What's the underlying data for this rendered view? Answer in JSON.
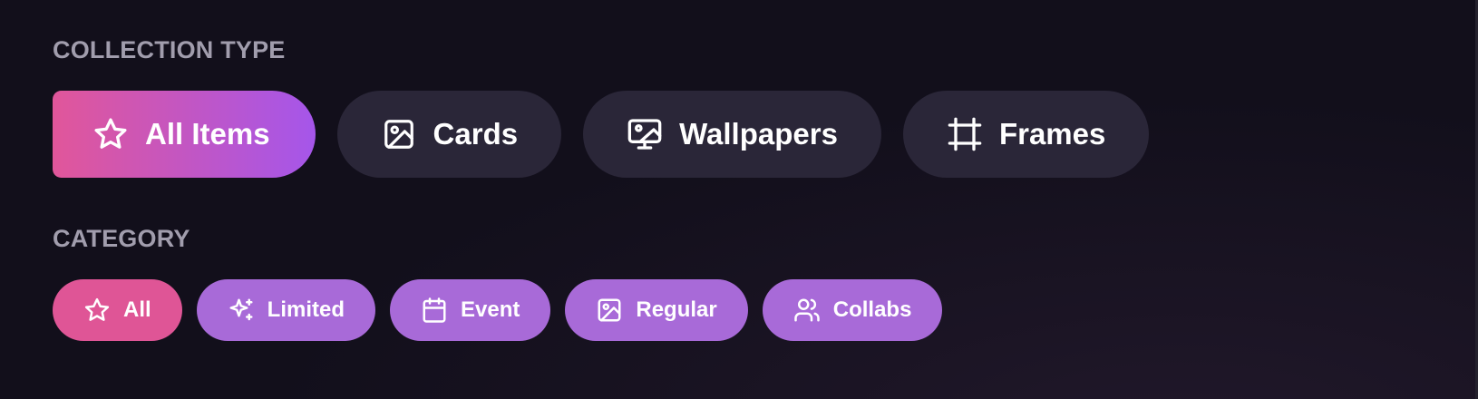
{
  "collection_type": {
    "label": "COLLECTION TYPE",
    "options": [
      {
        "label": "All Items",
        "icon": "star-icon",
        "active": true
      },
      {
        "label": "Cards",
        "icon": "image-icon",
        "active": false
      },
      {
        "label": "Wallpapers",
        "icon": "monitor-image-icon",
        "active": false
      },
      {
        "label": "Frames",
        "icon": "frame-icon",
        "active": false
      }
    ]
  },
  "category": {
    "label": "CATEGORY",
    "options": [
      {
        "label": "All",
        "icon": "star-icon",
        "active": true
      },
      {
        "label": "Limited",
        "icon": "sparkles-icon",
        "active": false
      },
      {
        "label": "Event",
        "icon": "calendar-icon",
        "active": false
      },
      {
        "label": "Regular",
        "icon": "image-icon",
        "active": false
      },
      {
        "label": "Collabs",
        "icon": "users-icon",
        "active": false
      }
    ]
  },
  "colors": {
    "background": "#120f1b",
    "pill_inactive_large": "#2a2638",
    "active_gradient_start": "#e1569a",
    "active_gradient_end": "#a556ea",
    "pill_inactive_small": "#a86ad8",
    "pill_active_small": "#df5596",
    "section_label": "#a19dad"
  }
}
